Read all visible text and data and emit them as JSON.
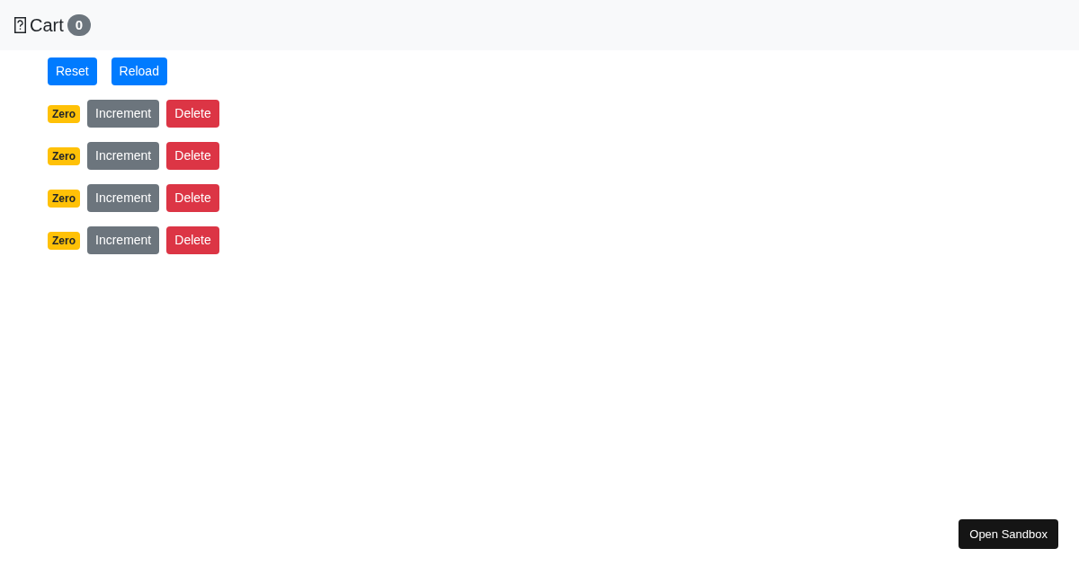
{
  "navbar": {
    "title": "Cart",
    "count": "0"
  },
  "toolbar": [
    "Reset",
    "Reload"
  ],
  "counters": [
    {
      "badge": "Zero",
      "increment": "Increment",
      "delete": "Delete"
    },
    {
      "badge": "Zero",
      "increment": "Increment",
      "delete": "Delete"
    },
    {
      "badge": "Zero",
      "increment": "Increment",
      "delete": "Delete"
    },
    {
      "badge": "Zero",
      "increment": "Increment",
      "delete": "Delete"
    }
  ],
  "sandbox_button": "Open Sandbox"
}
